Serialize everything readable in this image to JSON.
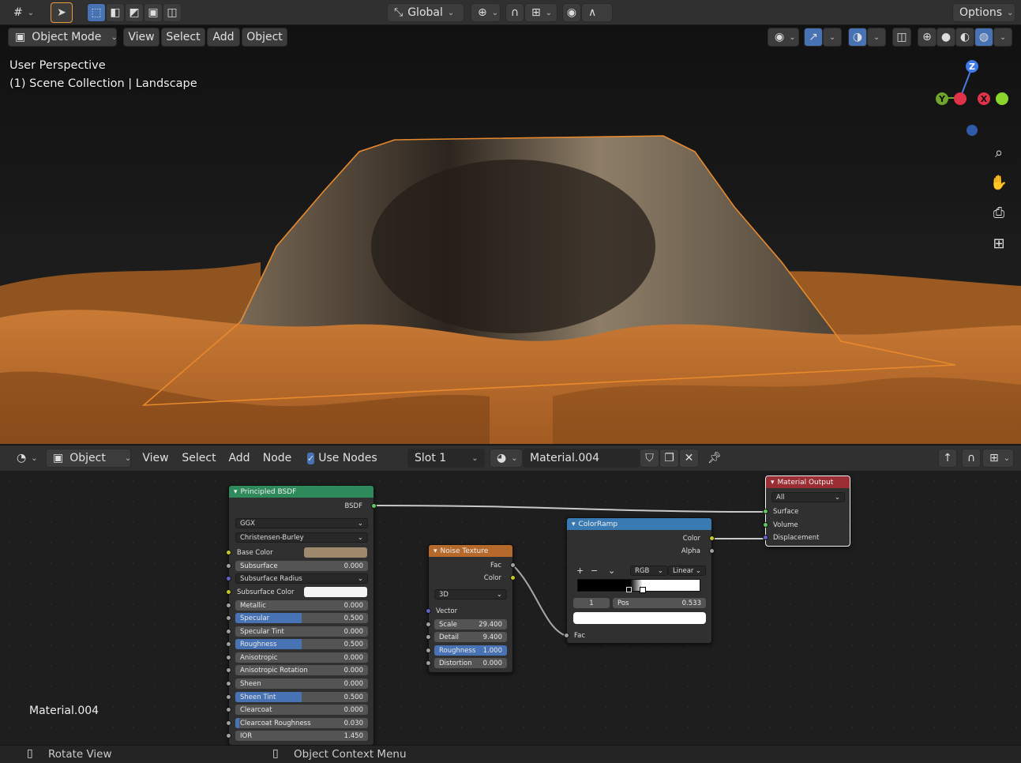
{
  "topbar": {
    "transform_orientation": "Global",
    "options_label": "Options"
  },
  "viewport_header": {
    "mode": "Object Mode",
    "menus": [
      "View",
      "Select",
      "Add",
      "Object"
    ]
  },
  "viewport": {
    "perspective": "User Perspective",
    "collection": "(1) Scene Collection | Landscape",
    "gizmo": {
      "z": "Z",
      "y": "Y",
      "x": "X"
    }
  },
  "node_header": {
    "type": "Object",
    "menus": [
      "View",
      "Select",
      "Add",
      "Node"
    ],
    "use_nodes_label": "Use Nodes",
    "slot": "Slot 1",
    "material": "Material.004"
  },
  "node_editor": {
    "material_label": "Material.004",
    "principled": {
      "title": "Principled BSDF",
      "output": "BSDF",
      "distribution": "GGX",
      "subsurface_method": "Christensen-Burley",
      "base_color_label": "Base Color",
      "base_color": "#a08a6e",
      "subsurface_radius": "Subsurface Radius",
      "subsurface_color_label": "Subsurface Color",
      "fields": [
        {
          "label": "Subsurface",
          "value": "0.000",
          "fill": 0
        },
        {
          "label": "Metallic",
          "value": "0.000",
          "fill": 0
        },
        {
          "label": "Specular",
          "value": "0.500",
          "fill": 0.5
        },
        {
          "label": "Specular Tint",
          "value": "0.000",
          "fill": 0
        },
        {
          "label": "Roughness",
          "value": "0.500",
          "fill": 0.5
        },
        {
          "label": "Anisotropic",
          "value": "0.000",
          "fill": 0
        },
        {
          "label": "Anisotropic Rotation",
          "value": "0.000",
          "fill": 0
        },
        {
          "label": "Sheen",
          "value": "0.000",
          "fill": 0
        },
        {
          "label": "Sheen Tint",
          "value": "0.500",
          "fill": 0.5
        },
        {
          "label": "Clearcoat",
          "value": "0.000",
          "fill": 0
        },
        {
          "label": "Clearcoat Roughness",
          "value": "0.030",
          "fill": 0.03
        },
        {
          "label": "IOR",
          "value": "1.450",
          "fill": 0
        }
      ]
    },
    "noise": {
      "title": "Noise Texture",
      "outputs": [
        "Fac",
        "Color"
      ],
      "dimension": "3D",
      "vector": "Vector",
      "fields": [
        {
          "label": "Scale",
          "value": "29.400",
          "fill": 0
        },
        {
          "label": "Detail",
          "value": "9.400",
          "fill": 0
        },
        {
          "label": "Roughness",
          "value": "1.000",
          "fill": 1
        },
        {
          "label": "Distortion",
          "value": "0.000",
          "fill": 0
        }
      ]
    },
    "colorramp": {
      "title": "ColorRamp",
      "outputs": [
        "Color",
        "Alpha"
      ],
      "add": "+",
      "remove": "−",
      "color_mode": "RGB",
      "interpolation": "Linear",
      "index": "1",
      "pos_label": "Pos",
      "pos_value": "0.533",
      "input": "Fac"
    },
    "output": {
      "title": "Material Output",
      "target": "All",
      "inputs": [
        "Surface",
        "Volume",
        "Displacement"
      ]
    }
  },
  "statusbar": {
    "left": "Rotate View",
    "middle": "Object Context Menu"
  },
  "colors": {
    "accent": "#4772b3",
    "selection_outline": "#e8892c",
    "shader_header": "#2e8a5a",
    "texture_header": "#b5692a",
    "converter_header": "#3a7ab2",
    "output_header": "#9b2d35"
  }
}
